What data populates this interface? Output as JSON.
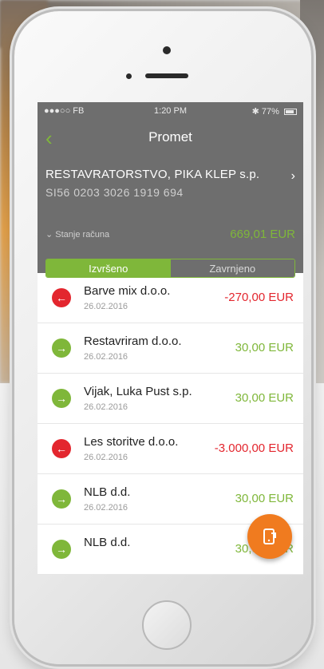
{
  "status_bar": {
    "carrier": "●●●○○ FB",
    "time": "1:20 PM",
    "battery": "77%"
  },
  "nav": {
    "back_icon": "chevron-left-icon",
    "title": "Promet"
  },
  "account": {
    "name": "RESTAVRATORSTVO, PIKA KLEP s.p.",
    "iban": "SI56 0203 3026 1919 694",
    "balance_label": "Stanje računa",
    "balance_value": "669,01 EUR"
  },
  "tabs": [
    {
      "label": "Izvršeno",
      "active": true
    },
    {
      "label": "Zavrnjeno",
      "active": false
    }
  ],
  "transactions": [
    {
      "name": "Barve mix d.o.o.",
      "date": "26.02.2016",
      "amount": "-270,00 EUR",
      "direction": "out"
    },
    {
      "name": "Restavriram d.o.o.",
      "date": "26.02.2016",
      "amount": "30,00 EUR",
      "direction": "in"
    },
    {
      "name": "Vijak, Luka Pust s.p.",
      "date": "26.02.2016",
      "amount": "30,00 EUR",
      "direction": "in"
    },
    {
      "name": "Les storitve d.o.o.",
      "date": "26.02.2016",
      "amount": "-3.000,00 EUR",
      "direction": "out"
    },
    {
      "name": "NLB d.d.",
      "date": "26.02.2016",
      "amount": "30,00 EUR",
      "direction": "in"
    },
    {
      "name": "NLB d.d.",
      "date": "",
      "amount": "30,00 EUR",
      "direction": "in"
    }
  ],
  "colors": {
    "accent_green": "#7fb73a",
    "negative_red": "#e3262e",
    "header_gray": "#6e6e6e",
    "fab_orange": "#f07b1f"
  }
}
